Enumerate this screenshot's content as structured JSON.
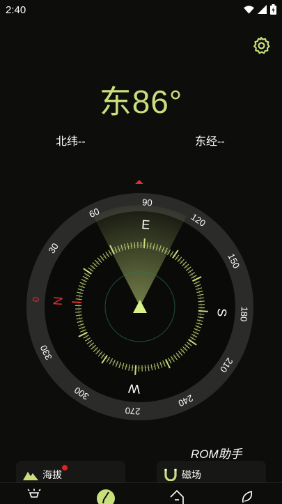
{
  "status_bar": {
    "time": "2:40"
  },
  "compass": {
    "heading_text": "东86°",
    "latitude_text": "北纬--",
    "longitude_text": "东经--",
    "heading_deg": 86,
    "outer_labels": [
      "0",
      "30",
      "60",
      "90",
      "120",
      "150",
      "180",
      "210",
      "240",
      "270",
      "300",
      "330"
    ],
    "cardinals": [
      "N",
      "E",
      "S",
      "W"
    ]
  },
  "watermark": "ROM助手",
  "cards": {
    "altitude_label": "海拔",
    "magnetic_label": "磁场"
  },
  "bottom_nav": {
    "items": [
      "flashlight-icon",
      "compass-icon",
      "home-icon",
      "leaf-icon"
    ],
    "active_index": 1
  },
  "colors": {
    "accent": "#c9df7c",
    "north_red": "#e03030",
    "background": "#0d0d0c",
    "ring": "#2b2b2a"
  }
}
